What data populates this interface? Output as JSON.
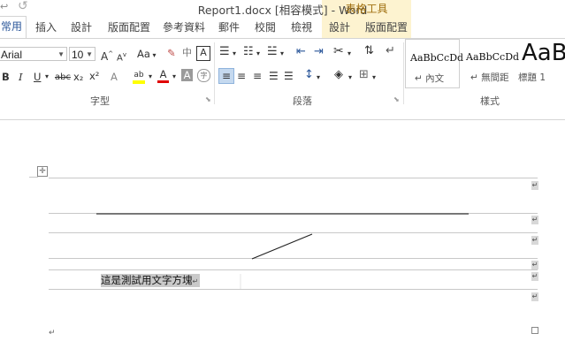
{
  "titlebar": {
    "undo_icon": "undo-icon",
    "redo_icon": "redo-icon",
    "title": "Report1.docx [相容模式] - Word",
    "contextual": "表格工具"
  },
  "tabs": [
    {
      "label": "常用",
      "active": true
    },
    {
      "label": "插入"
    },
    {
      "label": "設計"
    },
    {
      "label": "版面配置"
    },
    {
      "label": "參考資料"
    },
    {
      "label": "郵件"
    },
    {
      "label": "校閱"
    },
    {
      "label": "檢視"
    },
    {
      "label": "設計"
    },
    {
      "label": "版面配置"
    }
  ],
  "font": {
    "name": "Arial",
    "size": "10",
    "grow": "A",
    "shrink": "A",
    "change_case": "Aa",
    "bold": "B",
    "italic": "I",
    "underline": "U",
    "strikethrough": "abc",
    "subscript": "x₂",
    "superscript": "x²",
    "highlight_text": "ab",
    "font_color_text": "A",
    "char_shading_text": "A",
    "enclose_text": "字",
    "phonetic_text": "中",
    "border_text": "A",
    "group_label": "字型"
  },
  "paragraph": {
    "group_label": "段落"
  },
  "styles": {
    "group_label": "樣式",
    "items": [
      {
        "sample": "AaBbCcDd",
        "name": "內文"
      },
      {
        "sample": "AaBbCcDd",
        "name": "無間距"
      },
      {
        "sample": "AaB",
        "name": "標題 1"
      }
    ]
  },
  "document": {
    "cell_text": "這是測試用文字方塊"
  }
}
